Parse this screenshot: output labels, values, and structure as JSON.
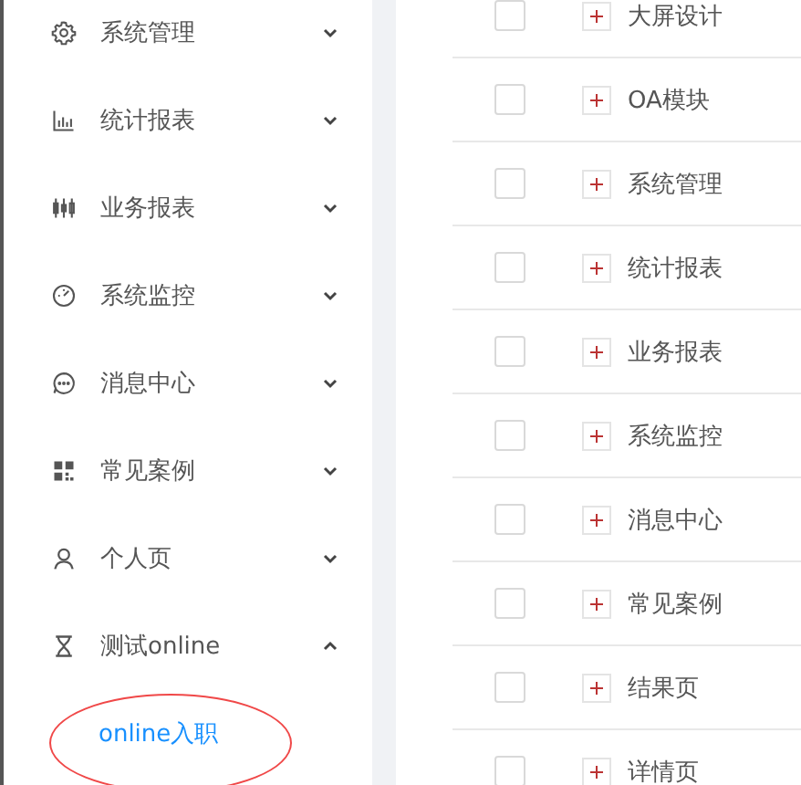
{
  "sidebar": {
    "items": [
      {
        "label": "系统管理",
        "expanded": false
      },
      {
        "label": "统计报表",
        "expanded": false
      },
      {
        "label": "业务报表",
        "expanded": false
      },
      {
        "label": "系统监控",
        "expanded": false
      },
      {
        "label": "消息中心",
        "expanded": false
      },
      {
        "label": "常见案例",
        "expanded": false
      },
      {
        "label": "个人页",
        "expanded": false
      },
      {
        "label": "测试online",
        "expanded": true,
        "children": [
          {
            "label": "online入职",
            "selected": true,
            "circled": true
          }
        ]
      }
    ]
  },
  "table": {
    "rows": [
      {
        "name": "大屏设计",
        "checked": false
      },
      {
        "name": "OA模块",
        "checked": false
      },
      {
        "name": "系统管理",
        "checked": false
      },
      {
        "name": "统计报表",
        "checked": false
      },
      {
        "name": "业务报表",
        "checked": false
      },
      {
        "name": "系统监控",
        "checked": false
      },
      {
        "name": "消息中心",
        "checked": false
      },
      {
        "name": "常见案例",
        "checked": false
      },
      {
        "name": "结果页",
        "checked": false
      },
      {
        "name": "详情页",
        "checked": false
      }
    ]
  }
}
